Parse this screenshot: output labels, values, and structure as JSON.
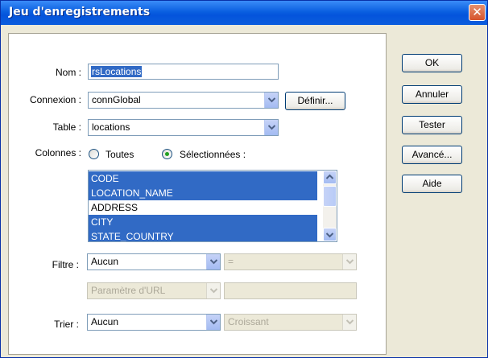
{
  "window": {
    "title": "Jeu d'enregistrements",
    "close_glyph": "✕"
  },
  "form": {
    "name_label": "Nom :",
    "name_value": "rsLocations",
    "connection_label": "Connexion :",
    "connection_value": "connGlobal",
    "define_button": "Définir...",
    "table_label": "Table :",
    "table_value": "locations",
    "columns_label": "Colonnes :",
    "radio_all": "Toutes",
    "radio_selected": "Sélectionnées :",
    "radio_checked": "selected",
    "columns_list": [
      {
        "label": "CODE",
        "selected": true
      },
      {
        "label": "LOCATION_NAME",
        "selected": true
      },
      {
        "label": "ADDRESS",
        "selected": false
      },
      {
        "label": "CITY",
        "selected": true
      },
      {
        "label": "STATE_COUNTRY",
        "selected": true
      }
    ],
    "filter_label": "Filtre :",
    "filter_value": "Aucun",
    "filter_operator": "=",
    "filter_param_type": "Paramètre d'URL",
    "filter_param_value": "",
    "sort_label": "Trier :",
    "sort_value": "Aucun",
    "sort_order": "Croissant"
  },
  "buttons": {
    "ok": "OK",
    "cancel": "Annuler",
    "test": "Tester",
    "advanced": "Avancé...",
    "help": "Aide"
  },
  "colors": {
    "titlebar": "#0a5fe0",
    "selection": "#316ac5",
    "dialog_bg": "#ece9d8"
  }
}
